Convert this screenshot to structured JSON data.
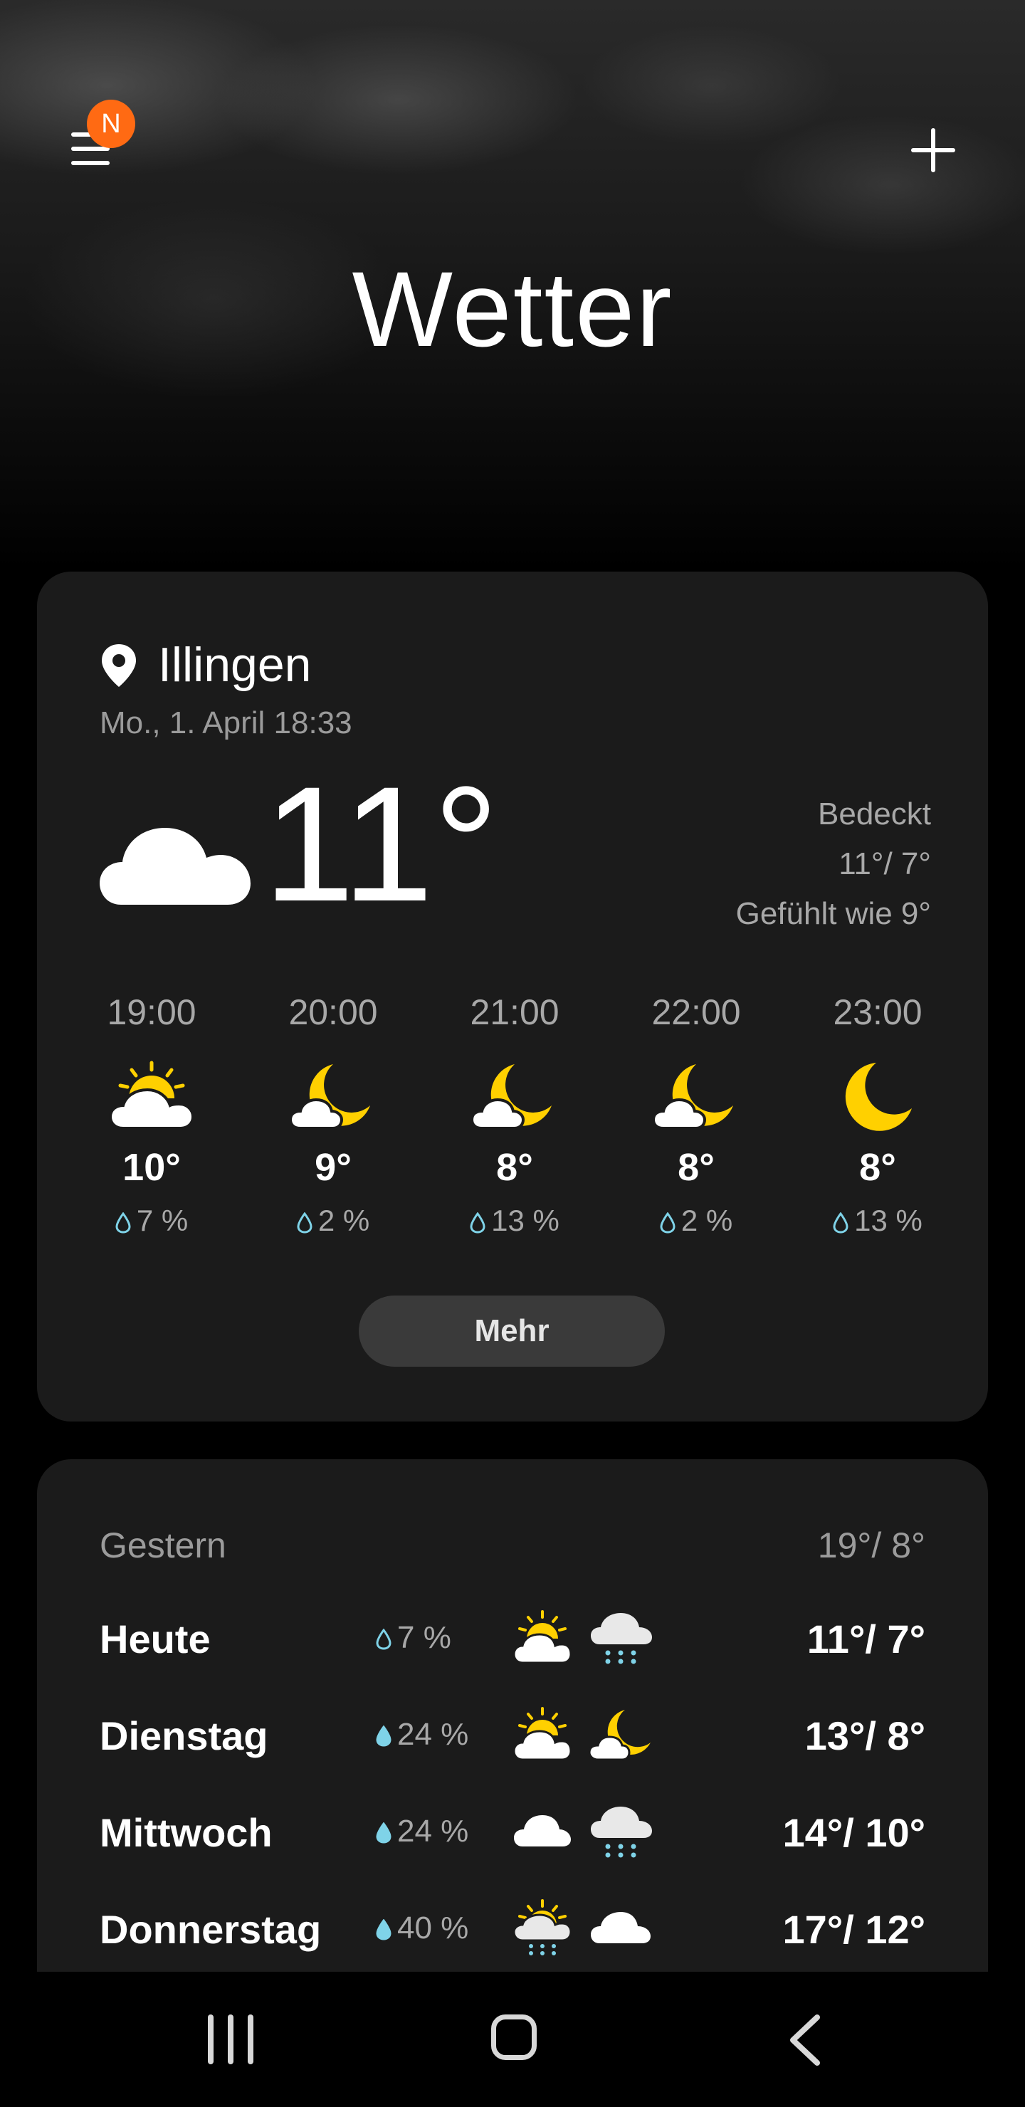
{
  "header": {
    "menu_badge": "N",
    "title": "Wetter"
  },
  "current": {
    "location": "Illingen",
    "datetime": "Mo., 1. April 18:33",
    "temperature": "11°",
    "condition": "Bedeckt",
    "high_low": "11°/ 7°",
    "feels_like": "Gefühlt wie 9°",
    "icon": "cloud-icon"
  },
  "hourly": [
    {
      "time": "19:00",
      "temp": "10°",
      "rain": "7 %",
      "icon": "sun-cloud-icon"
    },
    {
      "time": "20:00",
      "temp": "9°",
      "rain": "2 %",
      "icon": "moon-cloud-icon"
    },
    {
      "time": "21:00",
      "temp": "8°",
      "rain": "13 %",
      "icon": "moon-cloud-icon"
    },
    {
      "time": "22:00",
      "temp": "8°",
      "rain": "2 %",
      "icon": "moon-cloud-icon"
    },
    {
      "time": "23:00",
      "temp": "8°",
      "rain": "13 %",
      "icon": "moon-icon"
    }
  ],
  "more_button": "Mehr",
  "daily": {
    "yesterday_label": "Gestern",
    "yesterday_temp": "19°/ 8°",
    "days": [
      {
        "name": "Heute",
        "rain": "7 %",
        "day_icon": "sun-cloud-icon",
        "night_icon": "rain-cloud-icon",
        "temp": "11°/ 7°"
      },
      {
        "name": "Dienstag",
        "rain": "24 %",
        "day_icon": "sun-cloud-icon",
        "night_icon": "moon-cloud-icon",
        "temp": "13°/ 8°"
      },
      {
        "name": "Mittwoch",
        "rain": "24 %",
        "day_icon": "cloud-icon",
        "night_icon": "rain-cloud-icon",
        "temp": "14°/ 10°"
      },
      {
        "name": "Donnerstag",
        "rain": "40 %",
        "day_icon": "sun-rain-cloud-icon",
        "night_icon": "cloud-icon",
        "temp": "17°/ 12°"
      }
    ]
  },
  "colors": {
    "badge": "#ff6a13",
    "sun": "#ffd000",
    "rain_drop": "#7fd3e8",
    "card": "#1b1b1b"
  }
}
